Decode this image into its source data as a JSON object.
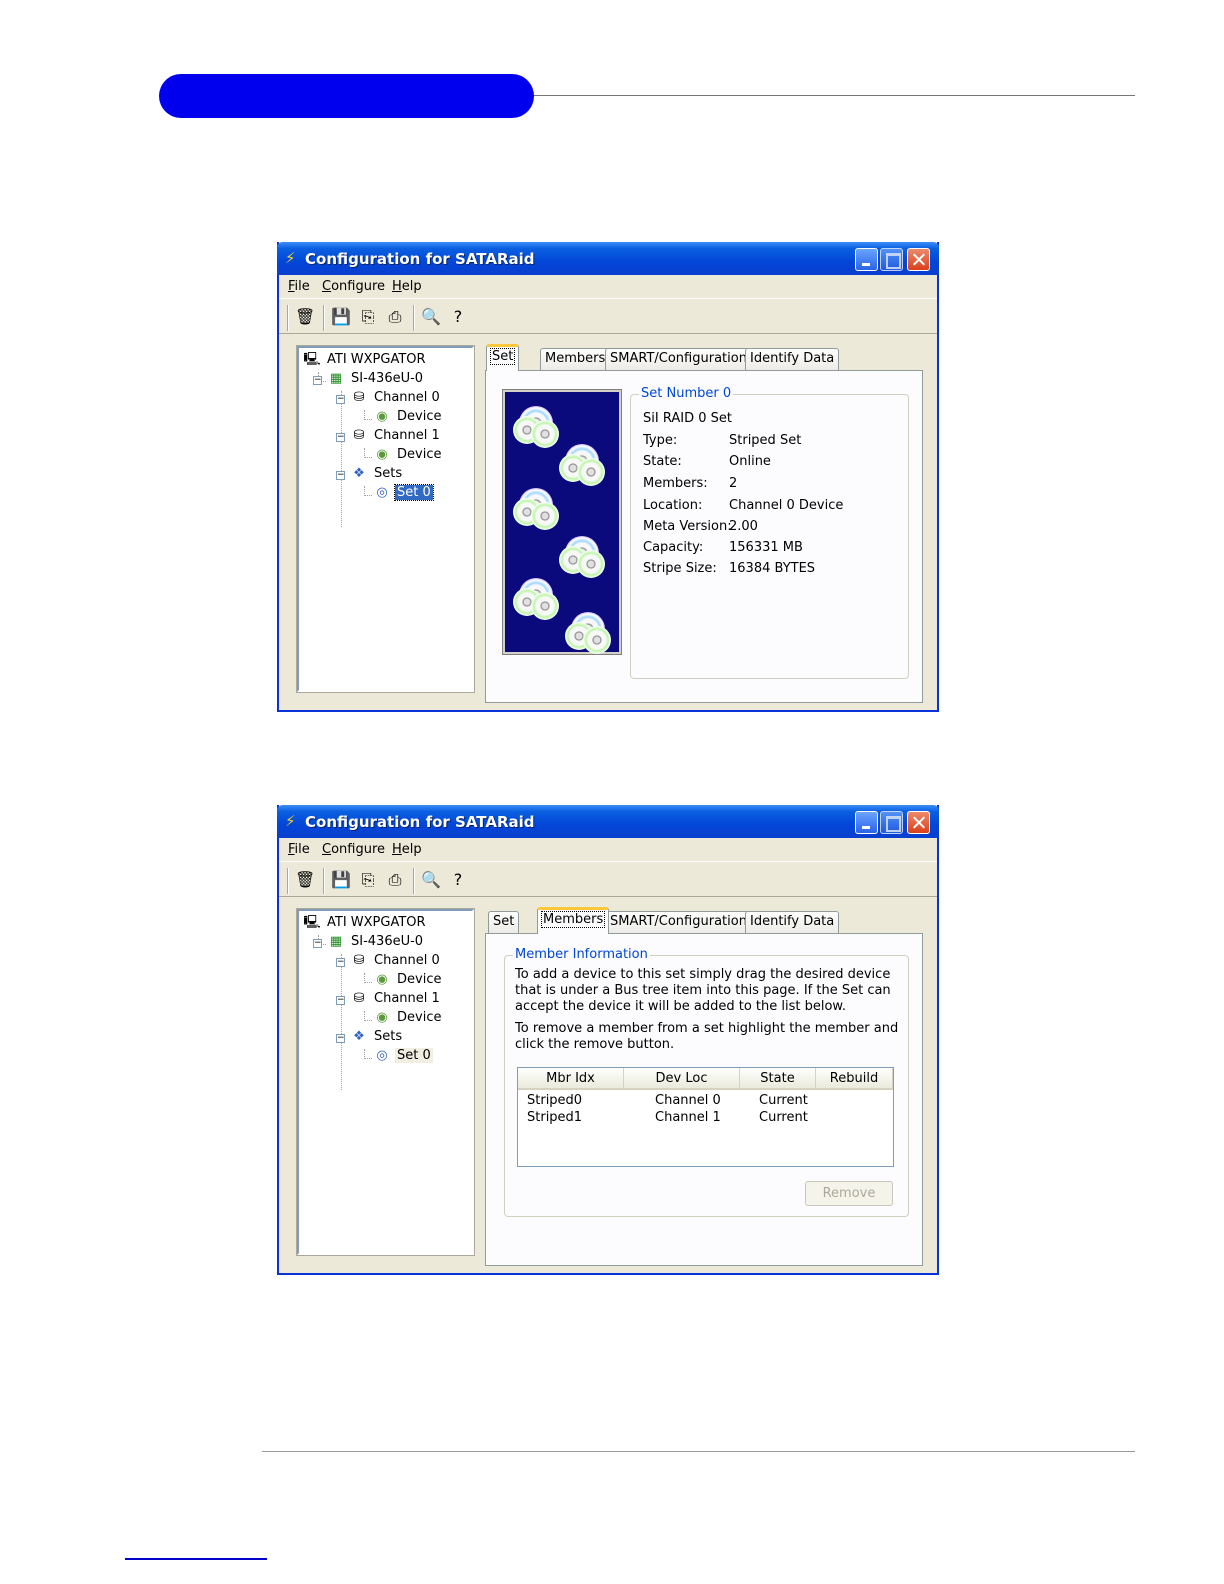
{
  "windows": [
    {
      "title": "Configuration for SATARaid",
      "menu": [
        "File",
        "Configure",
        "Help"
      ],
      "tree": {
        "root": "ATI WXPGATOR",
        "controller": "SI-436eU-0",
        "channel0": "Channel 0",
        "channel0_device": "Device",
        "channel1": "Channel 1",
        "channel1_device": "Device",
        "sets": "Sets",
        "set0": "Set 0"
      },
      "tabs": [
        "Set",
        "Members",
        "SMART/Configuration",
        "Identify Data"
      ],
      "active_tab": "Set",
      "set_info": {
        "group_title": "Set Number 0",
        "heading": "SiI RAID 0 Set",
        "rows": [
          {
            "label": "Type:",
            "value": "Striped Set"
          },
          {
            "label": "State:",
            "value": "Online"
          },
          {
            "label": "Members:",
            "value": "2"
          },
          {
            "label": "Location:",
            "value": "Channel 0 Device"
          },
          {
            "label": "Meta Version:",
            "value": "2.00"
          },
          {
            "label": "Capacity:",
            "value": "156331 MB"
          },
          {
            "label": "Stripe Size:",
            "value": "16384 BYTES"
          }
        ]
      }
    },
    {
      "title": "Configuration for SATARaid",
      "menu": [
        "File",
        "Configure",
        "Help"
      ],
      "tree": {
        "root": "ATI WXPGATOR",
        "controller": "SI-436eU-0",
        "channel0": "Channel 0",
        "channel0_device": "Device",
        "channel1": "Channel 1",
        "channel1_device": "Device",
        "sets": "Sets",
        "set0": "Set 0"
      },
      "tabs": [
        "Set",
        "Members",
        "SMART/Configuration",
        "Identify Data"
      ],
      "active_tab": "Members",
      "member_info": {
        "group_title": "Member Information",
        "text1": "To add a device to this set simply drag the desired device that is under a Bus tree item into this page.  If the Set can accept the device it will be added to the list below.",
        "text2": "To remove a member from a set highlight the member and click the remove button.",
        "columns": [
          "Mbr Idx",
          "Dev Loc",
          "State",
          "Rebuild"
        ],
        "rows": [
          [
            "Striped0",
            "Channel 0",
            "Current",
            ""
          ],
          [
            "Striped1",
            "Channel 1",
            "Current",
            ""
          ]
        ],
        "remove_label": "Remove"
      }
    }
  ],
  "colors": {
    "accent": "#0000ee",
    "titlebar": "#0346d8",
    "selection": "#316ac5",
    "groupbox_title": "#0046d5",
    "disc_background": "#0a0a7c"
  },
  "icons": {
    "computer": "computer-icon",
    "controller": "raid-card-icon",
    "channel": "drive-channel-icon",
    "device": "disk-device-icon",
    "sets": "disk-sets-icon",
    "set": "disk-set-icon"
  }
}
